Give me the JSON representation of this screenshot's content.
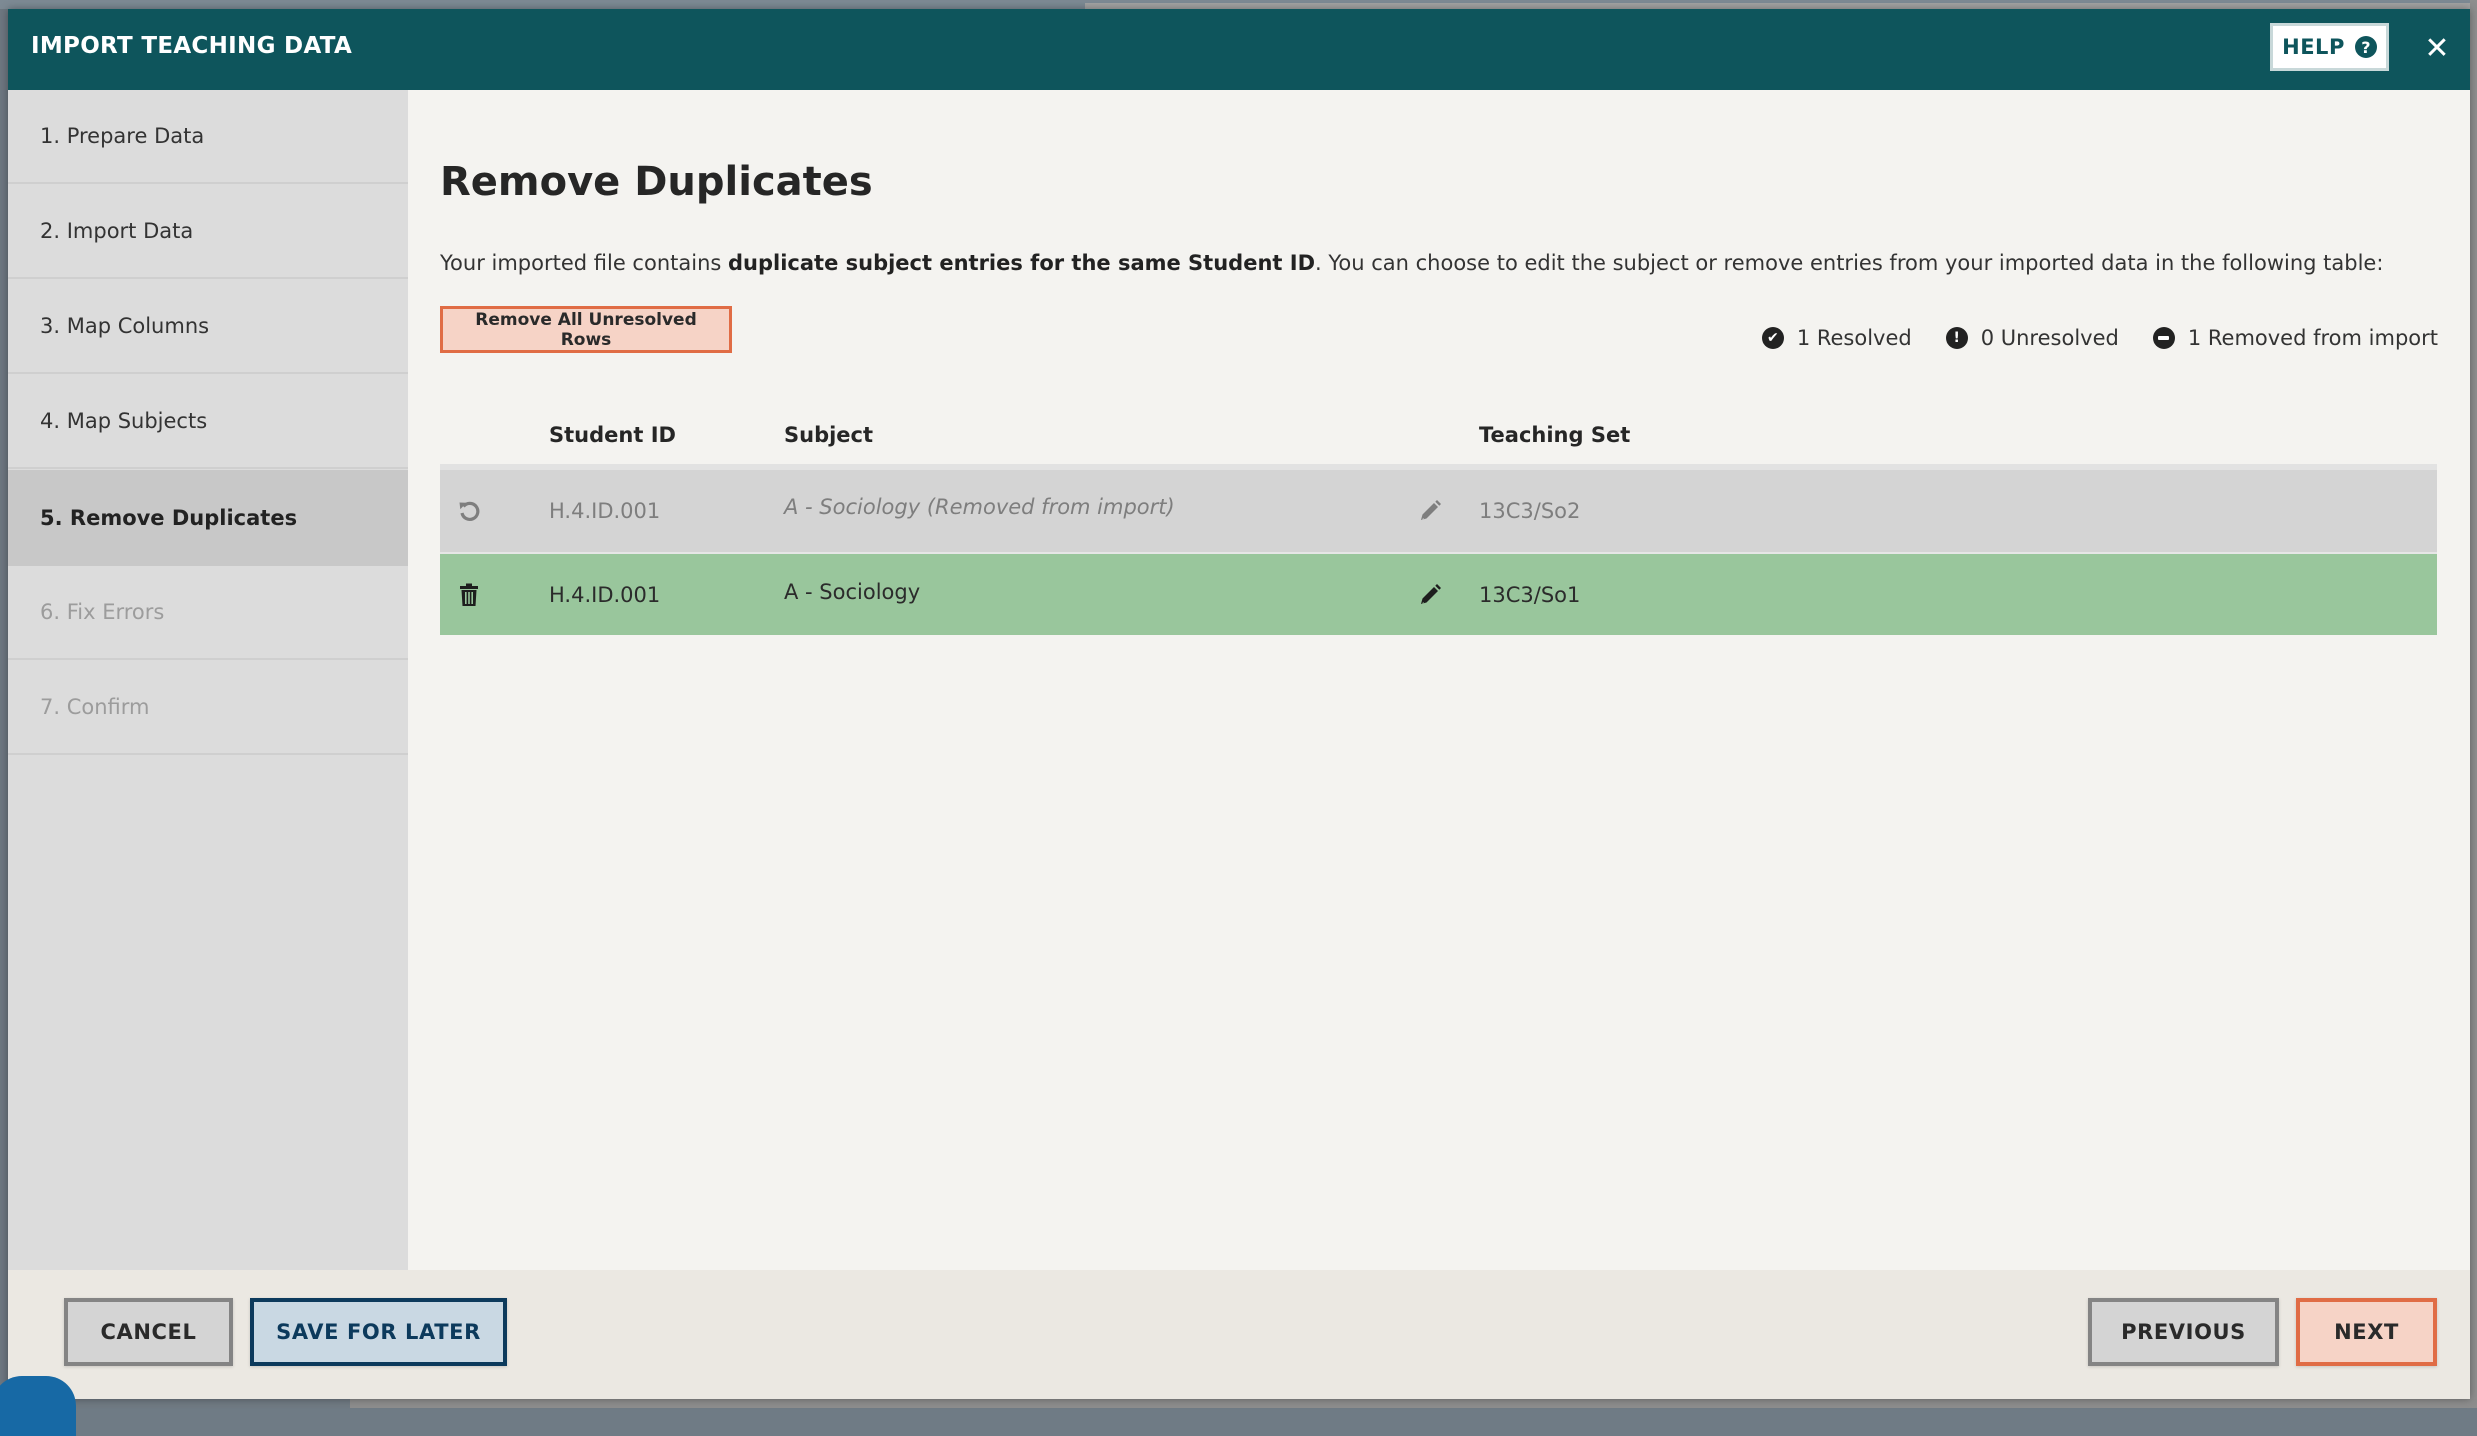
{
  "dialog": {
    "title": "IMPORT TEACHING DATA",
    "help_label": "HELP",
    "help_icon": "question-circle-icon",
    "close_icon": "close-icon",
    "close_glyph": "✕"
  },
  "steps": [
    {
      "label": "1. Prepare Data",
      "state": "done"
    },
    {
      "label": "2. Import Data",
      "state": "done"
    },
    {
      "label": "3. Map Columns",
      "state": "done"
    },
    {
      "label": "4. Map Subjects",
      "state": "done"
    },
    {
      "label": "5. Remove Duplicates",
      "state": "active"
    },
    {
      "label": "6. Fix Errors",
      "state": "disabled"
    },
    {
      "label": "7. Confirm",
      "state": "disabled"
    }
  ],
  "main": {
    "title": "Remove Duplicates",
    "description": {
      "prefix": "Your imported file contains ",
      "bold": "duplicate subject entries for the same Student ID",
      "suffix": ". You can choose to edit the subject or remove entries from your imported data in the following table:"
    },
    "remove_all_label": "Remove All Unresolved Rows",
    "legend": [
      {
        "icon": "check-circle-icon",
        "label": "1 Resolved"
      },
      {
        "icon": "exclamation-circle-icon",
        "label": "0 Unresolved"
      },
      {
        "icon": "minus-circle-icon",
        "label": "1 Removed from import"
      }
    ]
  },
  "table": {
    "columns": [
      "Student ID",
      "Subject",
      "Teaching Set"
    ],
    "rows": [
      {
        "status": "removed",
        "action_icon": "undo-icon",
        "student_id": "H.4.ID.001",
        "subject": "A - Sociology (Removed from import)",
        "edit_icon": "pencil-icon",
        "teaching_set": "13C3/So2"
      },
      {
        "status": "resolved",
        "action_icon": "trash-icon",
        "student_id": "H.4.ID.001",
        "subject": "A - Sociology",
        "edit_icon": "pencil-icon",
        "teaching_set": "13C3/So1"
      }
    ]
  },
  "footer": {
    "cancel_label": "CANCEL",
    "save_label": "SAVE FOR LATER",
    "previous_label": "PREVIOUS",
    "next_label": "NEXT"
  },
  "colors": {
    "header": "#0e555c",
    "resolved_row": "#99c69c",
    "removed_row": "#d4d4d4",
    "accent_orange": "#e06c45",
    "accent_navy": "#0c3a5c"
  }
}
